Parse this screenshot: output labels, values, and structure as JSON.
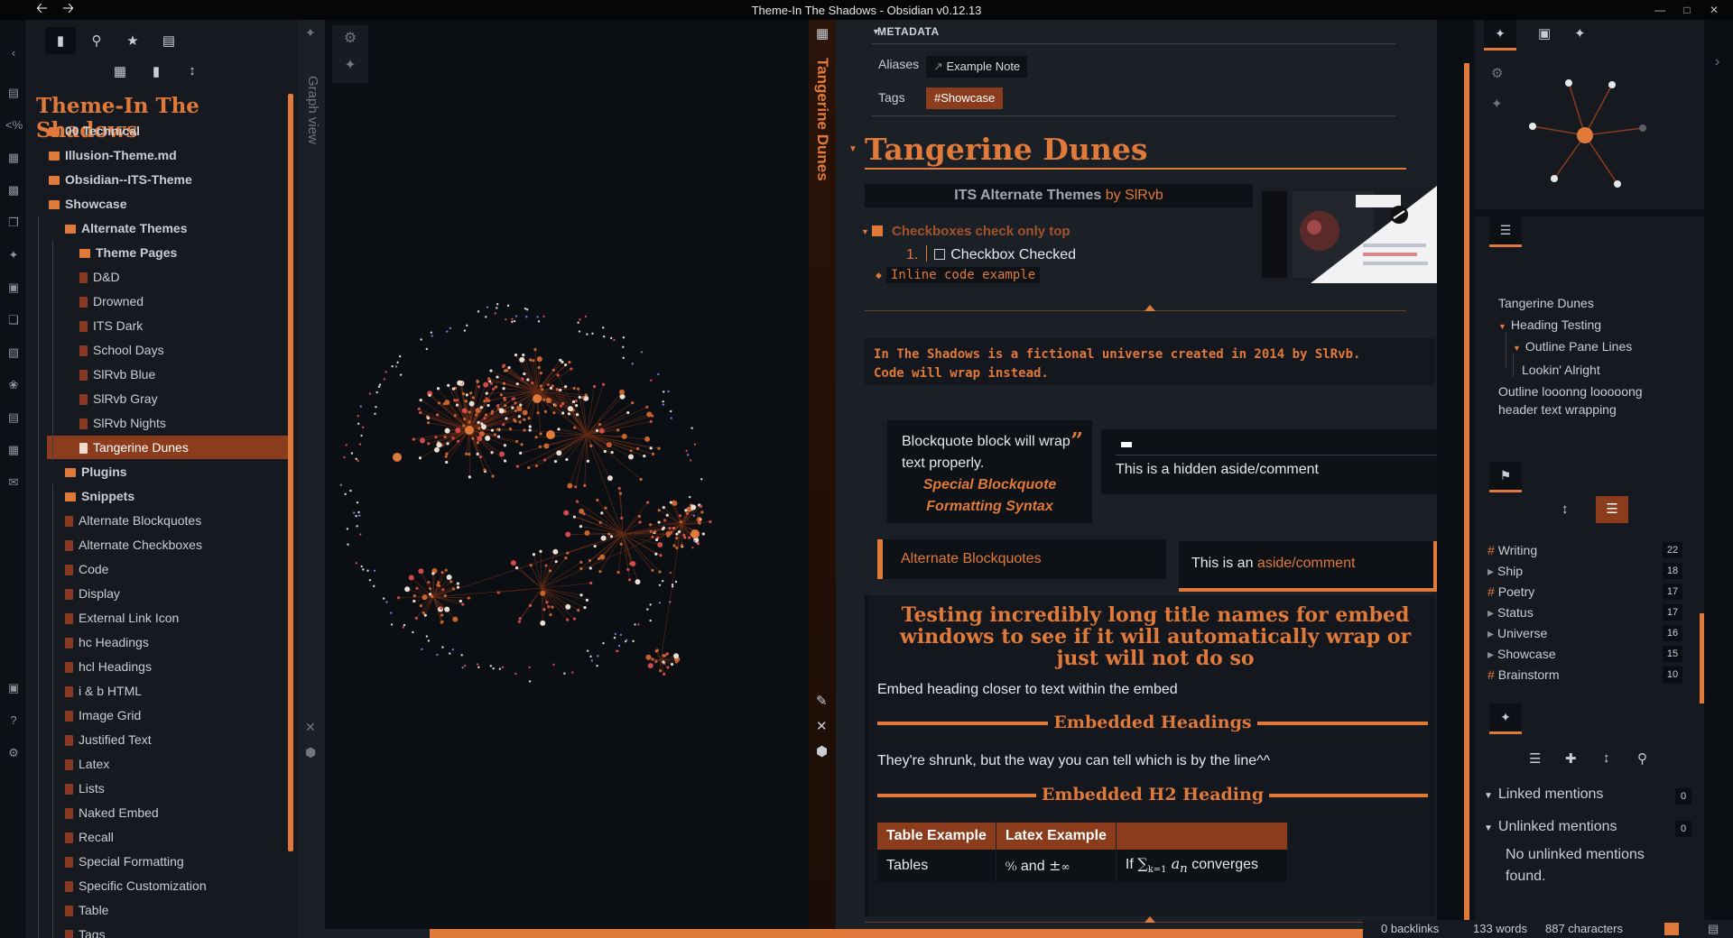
{
  "window": {
    "title": "Theme-In The Shadows - Obsidian v0.12.13"
  },
  "vault": {
    "name": "Theme-In The Shadows"
  },
  "left_tabs": [
    "files-icon",
    "search-icon",
    "star-icon",
    "inbox-icon"
  ],
  "file_tree": [
    {
      "label": "00 Technical",
      "type": "folder",
      "depth": 0
    },
    {
      "label": "Illusion-Theme.md",
      "type": "folder",
      "depth": 0
    },
    {
      "label": "Obsidian--ITS-Theme",
      "type": "folder",
      "depth": 0
    },
    {
      "label": "Showcase",
      "type": "folder",
      "depth": 0
    },
    {
      "label": "Alternate Themes",
      "type": "folder",
      "depth": 1
    },
    {
      "label": "Theme Pages",
      "type": "folder",
      "depth": 2
    },
    {
      "label": "D&D",
      "type": "file",
      "depth": 2
    },
    {
      "label": "Drowned",
      "type": "file",
      "depth": 2
    },
    {
      "label": "ITS Dark",
      "type": "file",
      "depth": 2
    },
    {
      "label": "School Days",
      "type": "file",
      "depth": 2
    },
    {
      "label": "SlRvb Blue",
      "type": "file",
      "depth": 2
    },
    {
      "label": "SlRvb Gray",
      "type": "file",
      "depth": 2
    },
    {
      "label": "SlRvb Nights",
      "type": "file",
      "depth": 2
    },
    {
      "label": "Tangerine Dunes",
      "type": "file",
      "depth": 2,
      "active": true
    },
    {
      "label": "Plugins",
      "type": "folder",
      "depth": 1
    },
    {
      "label": "Snippets",
      "type": "folder",
      "depth": 1
    },
    {
      "label": "Alternate Blockquotes",
      "type": "file",
      "depth": 1
    },
    {
      "label": "Alternate Checkboxes",
      "type": "file",
      "depth": 1
    },
    {
      "label": "Code",
      "type": "file",
      "depth": 1
    },
    {
      "label": "Display",
      "type": "file",
      "depth": 1
    },
    {
      "label": "External Link Icon",
      "type": "file",
      "depth": 1
    },
    {
      "label": "hc Headings",
      "type": "file",
      "depth": 1
    },
    {
      "label": "hcl Headings",
      "type": "file",
      "depth": 1
    },
    {
      "label": "i & b HTML",
      "type": "file",
      "depth": 1
    },
    {
      "label": "Image Grid",
      "type": "file",
      "depth": 1
    },
    {
      "label": "Justified Text",
      "type": "file",
      "depth": 1
    },
    {
      "label": "Latex",
      "type": "file",
      "depth": 1
    },
    {
      "label": "Lists",
      "type": "file",
      "depth": 1
    },
    {
      "label": "Naked Embed",
      "type": "file",
      "depth": 1
    },
    {
      "label": "Recall",
      "type": "file",
      "depth": 1
    },
    {
      "label": "Special Formatting",
      "type": "file",
      "depth": 1
    },
    {
      "label": "Specific Customization",
      "type": "file",
      "depth": 1
    },
    {
      "label": "Table",
      "type": "file",
      "depth": 1
    },
    {
      "label": "Tags",
      "type": "file",
      "depth": 1
    }
  ],
  "graph": {
    "tab_label": "Graph view"
  },
  "note": {
    "tab_label": "Tangerine Dunes",
    "metadata_title": "METADATA",
    "aliases_key": "Aliases",
    "alias_value": "Example Note",
    "tags_key": "Tags",
    "tag_value": "#Showcase",
    "h1": "Tangerine Dunes",
    "its_title": "ITS Alternate Themes",
    "its_by": "by SlRvb",
    "checkbox_heading": "Checkboxes check only top",
    "checkbox_num": "1.",
    "checkbox_item": "Checkbox Checked",
    "inline_code": "Inline code example",
    "code_line1": "In The Shadows is a fictional universe created in 2014 by SlRvb.",
    "code_line2": "Code will wrap instead.",
    "bq_text": "Blockquote block will wrap text properly.",
    "bq_special": "Special Blockquote Formatting Syntax",
    "aside_hidden": "This is a hidden aside/comment",
    "alt_bq": "Alternate Blockquotes",
    "aside_prefix": "This is an",
    "aside_link": "aside/comment",
    "embed_title": "Testing incredibly long title names for embed windows to see if it will automatically wrap or just will not do so",
    "embed_text1": "Embed heading closer to text within the embed",
    "embed_h1": "Embedded Headings",
    "embed_text2": "They're shrunk, but the way you can tell which is by the line^^",
    "embed_h2": "Embedded H2 Heading",
    "table": {
      "headers": [
        "Table Example",
        "Latex Example",
        ""
      ],
      "row": [
        "Tables",
        "and",
        "converges"
      ],
      "row_prefix": "If"
    }
  },
  "outline": [
    {
      "label": "Tangerine Dunes",
      "depth": 0
    },
    {
      "label": "Heading Testing",
      "depth": 0
    },
    {
      "label": "Outline Pane Lines",
      "depth": 1
    },
    {
      "label": "Lookin' Alright",
      "depth": 2
    },
    {
      "label": "Outline looonng looooong",
      "depth": 0
    },
    {
      "label": "header text wrapping",
      "depth": 0
    }
  ],
  "tags": [
    {
      "name": "Writing",
      "count": "22",
      "hash": true
    },
    {
      "name": "Ship",
      "count": "18",
      "hash": false
    },
    {
      "name": "Poetry",
      "count": "17",
      "hash": true
    },
    {
      "name": "Status",
      "count": "17",
      "hash": false
    },
    {
      "name": "Universe",
      "count": "16",
      "hash": false
    },
    {
      "name": "Showcase",
      "count": "15",
      "hash": false
    },
    {
      "name": "Brainstorm",
      "count": "10",
      "hash": true
    }
  ],
  "backlinks": {
    "linked": "Linked mentions",
    "linked_count": "0",
    "unlinked": "Unlinked mentions",
    "unlinked_count": "0",
    "none_text": "No unlinked mentions found."
  },
  "status": {
    "backlinks": "0 backlinks",
    "words": "133 words",
    "chars": "887 characters"
  },
  "colors": {
    "accent": "#e07a3a",
    "accent_dark": "#8a3c1c",
    "bg": "#0b0e13",
    "panel": "#1b1f26"
  }
}
